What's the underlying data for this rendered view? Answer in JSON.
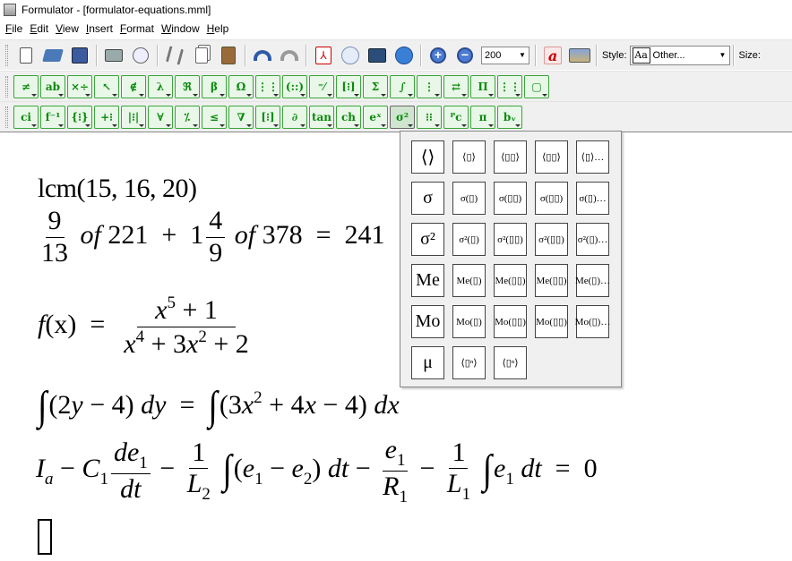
{
  "window": {
    "title": "Formulator - [formulator-equations.mml]"
  },
  "menu": [
    {
      "key": "F",
      "rest": "ile"
    },
    {
      "key": "E",
      "rest": "dit"
    },
    {
      "key": "V",
      "rest": "iew"
    },
    {
      "key": "I",
      "rest": "nsert"
    },
    {
      "key": "F",
      "rest": "ormat"
    },
    {
      "key": "W",
      "rest": "indow"
    },
    {
      "key": "H",
      "rest": "elp"
    }
  ],
  "toolbar": {
    "zoom_value": "200",
    "style_label": "Style:",
    "style_sample": "Aa",
    "style_value": "Other...",
    "size_label": "Size:",
    "font_button": "a"
  },
  "palette_row1": [
    "≠",
    "ab",
    "×÷",
    "↖",
    "∉",
    "λ",
    "ℜ",
    "β",
    "Ω",
    "⋮⋮",
    "(::)",
    "⁼⁄",
    "[⁝]",
    "Σ",
    "∫",
    "⋮",
    "⇄",
    "Π",
    "⋮⋮",
    "▢"
  ],
  "palette_row2": [
    "ci",
    "f⁻¹",
    "{⁝}",
    "+⁝",
    "|⁝|",
    "∀",
    "⁒",
    "≤",
    "∇",
    "[⁝]",
    "∂",
    "tan",
    "ch",
    "eˣ",
    "σ²",
    "⁝⁝",
    "ᴾc",
    "π",
    "bᵥ"
  ],
  "equations": {
    "lcm": "lcm(15, 16, 20)",
    "frac_num": "9",
    "frac_den": "13",
    "of": "of",
    "n221": "221",
    "plus": "+",
    "mixed_whole": "1",
    "mixed_num": "4",
    "mixed_den": "9",
    "n378": "378",
    "equals": "=",
    "n241": "241",
    "fx": "f",
    "fx_arg": "(x)",
    "poly_num_x": "x",
    "poly_num_exp": "5",
    "poly_num_rest": "+ 1",
    "poly_den_x": "x",
    "poly_den_exp4": "4",
    "poly_den_mid": "+ 3",
    "poly_den_x2": "x",
    "poly_den_exp2": "2",
    "poly_den_rest": "+ 2",
    "int_left": "(2",
    "int_y": "y",
    "int_left_rest": "− 4)",
    "dy": "dy",
    "int_right": "(3",
    "int_x": "x",
    "int_right_exp": "2",
    "int_right_mid": "+ 4",
    "int_right_x": "x",
    "int_right_rest": "− 4)",
    "dx": "dx",
    "circuit": {
      "I": "I",
      "a_sub": "a",
      "minus": "−",
      "C": "C",
      "one": "1",
      "de": "de",
      "dt": "dt",
      "L": "L",
      "two": "2",
      "paren_open": "(",
      "e": "e",
      "paren_close": ")",
      "R": "R",
      "zero": "0"
    }
  },
  "palette_popup": {
    "rows": [
      [
        "⟨⟩",
        "⟨▯⟩",
        "⟨▯▯⟩",
        "⟨▯▯⟩",
        "⟨▯⟩…"
      ],
      [
        "σ",
        "σ(▯)",
        "σ(▯▯)",
        "σ(▯▯)",
        "σ(▯)…"
      ],
      [
        "σ²",
        "σ²(▯)",
        "σ²(▯▯)",
        "σ²(▯▯)",
        "σ²(▯)…"
      ],
      [
        "Me",
        "Me(▯)",
        "Me(▯▯)",
        "Me(▯▯)",
        "Me(▯)…"
      ],
      [
        "Mo",
        "Mo(▯)",
        "Mo(▯▯)",
        "Mo(▯▯)",
        "Mo(▯)…"
      ],
      [
        "μ",
        "⟨▯ⁿ⟩",
        "⟨▯ⁿ⟩"
      ]
    ]
  }
}
